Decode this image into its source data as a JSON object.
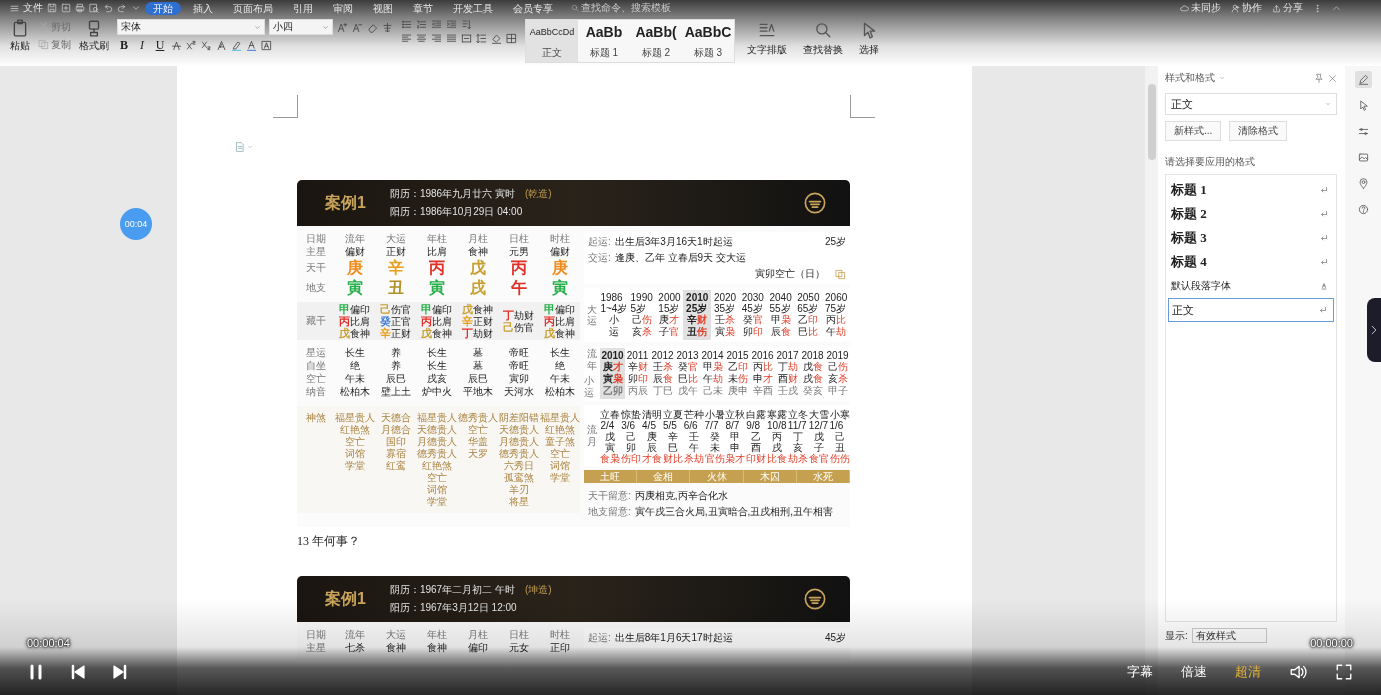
{
  "app": {
    "menu": "文件",
    "tabs": [
      {
        "label": "开始",
        "selected": true
      },
      {
        "label": "插入",
        "selected": false
      },
      {
        "label": "页面布局",
        "selected": false
      },
      {
        "label": "引用",
        "selected": false
      },
      {
        "label": "审阅",
        "selected": false
      },
      {
        "label": "视图",
        "selected": false
      },
      {
        "label": "章节",
        "selected": false
      },
      {
        "label": "开发工具",
        "selected": false
      },
      {
        "label": "会员专享",
        "selected": false
      }
    ],
    "search": {
      "placeholder": "查找命令、搜索模板"
    },
    "status": [
      "未同步",
      "协作",
      "分享"
    ]
  },
  "ribbon": {
    "clipboard": [
      {
        "label": "粘贴",
        "disabled": false
      },
      {
        "label": "剪切",
        "disabled": true
      },
      {
        "label": "复制",
        "disabled": true
      },
      {
        "label": "格式刷",
        "disabled": false
      }
    ],
    "font": "宋体",
    "size": "小四",
    "format": [
      "B",
      "I",
      "U"
    ],
    "styles": [
      {
        "sample": "AaBbCcDd",
        "label": "正文",
        "selected": true
      },
      {
        "sample": "AaBb",
        "label": "标题 1",
        "selected": false
      },
      {
        "sample": "AaBb(",
        "label": "标题 2",
        "selected": false
      },
      {
        "sample": "AaBbC",
        "label": "标题 3",
        "selected": false
      }
    ],
    "tools": [
      "文字排版",
      "查找替换",
      "选择"
    ]
  },
  "doc": {
    "blocks": [
      {
        "kind": "chart",
        "title": "案例1",
        "lunar": "阴历：1986年九月廿六 寅时",
        "gender": "(乾造)",
        "solar": "阳历：1986年10月29日 04:00",
        "row_labels": [
          "日期",
          "主星",
          "天干",
          "地支",
          "藏干",
          "星运",
          "自坐",
          "空亡",
          "纳音",
          "神煞"
        ],
        "columns": [
          {
            "header": "流年",
            "main_star": "偏财",
            "stem": {
              "text": "庚",
              "color": "#f08c1e"
            },
            "branch": {
              "text": "寅",
              "color": "#27b04a"
            },
            "hidden": [
              {
                "stem": "甲",
                "god": "偏印",
                "color": "#27b04a"
              },
              {
                "stem": "丙",
                "god": "比肩",
                "color": "#e0302a"
              },
              {
                "stem": "戊",
                "god": "食神",
                "color": "#c8a030"
              }
            ],
            "star_fortune": "长生",
            "self_seat": "绝",
            "void": "午未",
            "nayin": "松柏木",
            "spirits": [
              "福星贵人",
              "红艳煞",
              "空亡",
              "词馆",
              "学堂"
            ]
          },
          {
            "header": "大运",
            "main_star": "正财",
            "stem": {
              "text": "辛",
              "color": "#e8a020"
            },
            "branch": {
              "text": "丑",
              "color": "#b09028"
            },
            "hidden": [
              {
                "stem": "己",
                "god": "伤官",
                "color": "#c8a030"
              },
              {
                "stem": "癸",
                "god": "正官",
                "color": "#3a78d8"
              },
              {
                "stem": "辛",
                "god": "正财",
                "color": "#e8a020"
              }
            ],
            "star_fortune": "养",
            "self_seat": "养",
            "void": "辰巳",
            "nayin": "壁上土",
            "spirits": [
              "天德合",
              "月德合",
              "国印",
              "寡宿",
              "红鸾"
            ]
          },
          {
            "header": "年柱",
            "main_star": "比肩",
            "stem": {
              "text": "丙",
              "color": "#e0302a"
            },
            "branch": {
              "text": "寅",
              "color": "#27b04a"
            },
            "hidden": [
              {
                "stem": "甲",
                "god": "偏印",
                "color": "#27b04a"
              },
              {
                "stem": "丙",
                "god": "比肩",
                "color": "#e0302a"
              },
              {
                "stem": "戊",
                "god": "食神",
                "color": "#c8a030"
              }
            ],
            "star_fortune": "长生",
            "self_seat": "长生",
            "void": "戌亥",
            "nayin": "炉中火",
            "spirits": [
              "福星贵人",
              "天德贵人",
              "月德贵人",
              "德秀贵人",
              "红艳煞",
              "空亡",
              "词馆",
              "学堂"
            ]
          },
          {
            "header": "月柱",
            "main_star": "食神",
            "stem": {
              "text": "戊",
              "color": "#c8a030"
            },
            "branch": {
              "text": "戌",
              "color": "#c8a030"
            },
            "hidden": [
              {
                "stem": "戊",
                "god": "食神",
                "color": "#c8a030"
              },
              {
                "stem": "辛",
                "god": "正财",
                "color": "#e8a020"
              },
              {
                "stem": "丁",
                "god": "劫财",
                "color": "#e0302a"
              }
            ],
            "star_fortune": "墓",
            "self_seat": "墓",
            "void": "辰巳",
            "nayin": "平地木",
            "spirits": [
              "德秀贵人",
              "空亡",
              "华盖",
              "天罗"
            ]
          },
          {
            "header": "日柱",
            "main_star": "元男",
            "stem": {
              "text": "丙",
              "color": "#e0302a"
            },
            "branch": {
              "text": "午",
              "color": "#e0302a"
            },
            "hidden": [
              {
                "stem": "丁",
                "god": "劫财",
                "color": "#e0302a"
              },
              {
                "stem": "己",
                "god": "伤官",
                "color": "#c8a030"
              }
            ],
            "star_fortune": "帝旺",
            "self_seat": "帝旺",
            "void": "寅卯",
            "nayin": "天河水",
            "spirits": [
              "阴差阳错",
              "天德贵人",
              "月德贵人",
              "德秀贵人",
              "六秀日",
              "孤鸾煞",
              "羊刃",
              "将星"
            ]
          },
          {
            "header": "时柱",
            "main_star": "偏财",
            "stem": {
              "text": "庚",
              "color": "#f08c1e"
            },
            "branch": {
              "text": "寅",
              "color": "#27b04a"
            },
            "hidden": [
              {
                "stem": "甲",
                "god": "偏印",
                "color": "#27b04a"
              },
              {
                "stem": "丙",
                "god": "比肩",
                "color": "#e0302a"
              },
              {
                "stem": "戊",
                "god": "食神",
                "color": "#c8a030"
              }
            ],
            "star_fortune": "长生",
            "self_seat": "绝",
            "void": "午未",
            "nayin": "松柏木",
            "spirits": [
              "福星贵人",
              "红艳煞",
              "童子煞",
              "空亡",
              "词馆",
              "学堂"
            ]
          }
        ],
        "start": {
          "label": "起运:",
          "text": "出生后3年3月16天1时起运",
          "age": "25岁"
        },
        "handover": {
          "label": "交运:",
          "text": "逢庚、乙年 立春后9天 交大运",
          "void": "寅卯空亡（日）"
        },
        "decades": {
          "label": "大运",
          "items": [
            {
              "year": "1986",
              "age": "1~4岁",
              "stem": "小",
              "branch": "运",
              "selected": false
            },
            {
              "year": "1990",
              "age": "5岁",
              "stem": "己",
              "stem_god": "伤",
              "branch": "亥",
              "branch_god": "杀",
              "selected": false
            },
            {
              "year": "2000",
              "age": "15岁",
              "stem": "庚",
              "stem_god": "才",
              "branch": "子",
              "branch_god": "官",
              "selected": false
            },
            {
              "year": "2010",
              "age": "25岁",
              "stem": "辛",
              "stem_god": "财",
              "branch": "丑",
              "branch_god": "伤",
              "selected": true
            },
            {
              "year": "2020",
              "age": "35岁",
              "stem": "壬",
              "stem_god": "杀",
              "branch": "寅",
              "branch_god": "枭",
              "selected": false
            },
            {
              "year": "2030",
              "age": "45岁",
              "stem": "癸",
              "stem_god": "官",
              "branch": "卯",
              "branch_god": "印",
              "selected": false
            },
            {
              "year": "2040",
              "age": "55岁",
              "stem": "甲",
              "stem_god": "枭",
              "branch": "辰",
              "branch_god": "食",
              "selected": false
            },
            {
              "year": "2050",
              "age": "65岁",
              "stem": "乙",
              "stem_god": "印",
              "branch": "巳",
              "branch_god": "比",
              "selected": false
            },
            {
              "year": "2060",
              "age": "75岁",
              "stem": "丙",
              "stem_god": "比",
              "branch": "午",
              "branch_god": "劫",
              "selected": false
            }
          ]
        },
        "years": {
          "label": "流年",
          "sublabel": "小运",
          "items": [
            {
              "year": "2010",
              "stem": "庚",
              "stem_god": "才",
              "branch": "寅",
              "branch_god": "枭",
              "minor": "乙卯",
              "selected": true
            },
            {
              "year": "2011",
              "stem": "辛",
              "stem_god": "财",
              "branch": "卯",
              "branch_god": "印",
              "minor": "丙辰",
              "selected": false
            },
            {
              "year": "2012",
              "stem": "壬",
              "stem_god": "杀",
              "branch": "辰",
              "branch_god": "食",
              "minor": "丁巳",
              "selected": false
            },
            {
              "year": "2013",
              "stem": "癸",
              "stem_god": "官",
              "branch": "巳",
              "branch_god": "比",
              "minor": "戊午",
              "selected": false
            },
            {
              "year": "2014",
              "stem": "甲",
              "stem_god": "枭",
              "branch": "午",
              "branch_god": "劫",
              "minor": "己未",
              "selected": false
            },
            {
              "year": "2015",
              "stem": "乙",
              "stem_god": "印",
              "branch": "未",
              "branch_god": "伤",
              "minor": "庚申",
              "selected": false
            },
            {
              "year": "2016",
              "stem": "丙",
              "stem_god": "比",
              "branch": "申",
              "branch_god": "才",
              "minor": "辛酉",
              "selected": false
            },
            {
              "year": "2017",
              "stem": "丁",
              "stem_god": "劫",
              "branch": "酉",
              "branch_god": "财",
              "minor": "壬戌",
              "selected": false
            },
            {
              "year": "2018",
              "stem": "戊",
              "stem_god": "食",
              "branch": "戌",
              "branch_god": "食",
              "minor": "癸亥",
              "selected": false
            },
            {
              "year": "2019",
              "stem": "己",
              "stem_god": "伤",
              "branch": "亥",
              "branch_god": "杀",
              "minor": "甲子",
              "selected": false
            }
          ]
        },
        "months": {
          "label": "流月",
          "items": [
            {
              "term": "立春",
              "date": "2/4",
              "stem": "戊",
              "branch": "寅",
              "gods": "食枭"
            },
            {
              "term": "惊蛰",
              "date": "3/6",
              "stem": "己",
              "branch": "卯",
              "gods": "伤印"
            },
            {
              "term": "清明",
              "date": "4/5",
              "stem": "庚",
              "branch": "辰",
              "gods": "才食"
            },
            {
              "term": "立夏",
              "date": "5/5",
              "stem": "辛",
              "branch": "巳",
              "gods": "财比"
            },
            {
              "term": "芒种",
              "date": "6/6",
              "stem": "壬",
              "branch": "午",
              "gods": "杀劫"
            },
            {
              "term": "小暑",
              "date": "7/7",
              "stem": "癸",
              "branch": "未",
              "gods": "官伤"
            },
            {
              "term": "立秋",
              "date": "8/7",
              "stem": "甲",
              "branch": "申",
              "gods": "枭才"
            },
            {
              "term": "白露",
              "date": "9/8",
              "stem": "乙",
              "branch": "酉",
              "gods": "印财"
            },
            {
              "term": "寒露",
              "date": "10/8",
              "stem": "丙",
              "branch": "戌",
              "gods": "比食"
            },
            {
              "term": "立冬",
              "date": "11/7",
              "stem": "丁",
              "branch": "亥",
              "gods": "劫杀"
            },
            {
              "term": "大雪",
              "date": "12/7",
              "stem": "戊",
              "branch": "子",
              "gods": "食官"
            },
            {
              "term": "小寒",
              "date": "1/6",
              "stem": "己",
              "branch": "丑",
              "gods": "伤伤"
            }
          ]
        },
        "seasons": [
          "土旺",
          "金相",
          "火休",
          "木囚",
          "水死"
        ],
        "notes": [
          {
            "label": "天干留意:",
            "text": "丙庚相克,丙辛合化水"
          },
          {
            "label": "地支留意:",
            "text": "寅午戌三合火局,丑寅暗合,丑戌相刑,丑午相害"
          }
        ]
      },
      {
        "kind": "paragraph",
        "text": "13 年何事？"
      },
      {
        "kind": "chart",
        "title": "案例1",
        "lunar": "阴历：1967年二月初二 午时",
        "gender": "(坤造)",
        "solar": "阳历：1967年3月12日 12:00",
        "row_labels": [
          "日期",
          "主星"
        ],
        "columns": [
          {
            "header": "流年",
            "main_star": "七杀"
          },
          {
            "header": "大运",
            "main_star": "食神"
          },
          {
            "header": "年柱",
            "main_star": "食神"
          },
          {
            "header": "月柱",
            "main_star": "偏印"
          },
          {
            "header": "日柱",
            "main_star": "元女"
          },
          {
            "header": "时柱",
            "main_star": "正印"
          }
        ],
        "start": {
          "label": "起运:",
          "text": "出生后8年1月6天17时起运",
          "age": "45岁"
        }
      }
    ]
  },
  "sidebar": {
    "title": "样式和格式",
    "current": "正文",
    "buttons": [
      "新样式...",
      "清除格式"
    ],
    "prompt": "请选择要应用的格式",
    "styles": [
      {
        "label": "标题 1",
        "kind": "heading",
        "selected": false
      },
      {
        "label": "标题 2",
        "kind": "heading",
        "selected": false
      },
      {
        "label": "标题 3",
        "kind": "heading",
        "selected": false
      },
      {
        "label": "标题 4",
        "kind": "heading",
        "selected": false
      },
      {
        "label": "默认段落字体",
        "kind": "character",
        "selected": false
      },
      {
        "label": "正文",
        "kind": "paragraph",
        "selected": true
      }
    ],
    "show_label": "显示:",
    "show_value": "有效样式"
  },
  "player": {
    "badge": "00:04",
    "elapsed": "00:00:04",
    "remaining": "00:00:00",
    "buttons": [
      {
        "label": "字幕",
        "selected": false
      },
      {
        "label": "倍速",
        "selected": false
      },
      {
        "label": "超清",
        "selected": true
      }
    ]
  }
}
